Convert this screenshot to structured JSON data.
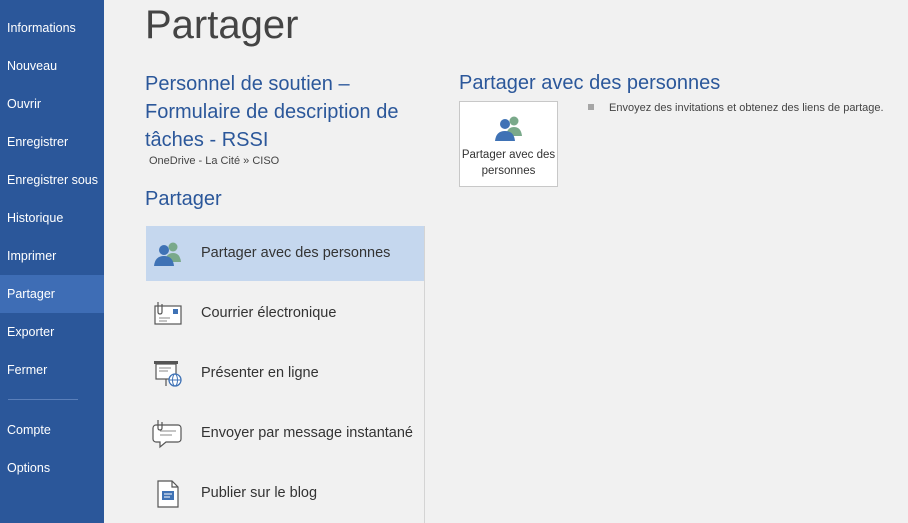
{
  "sidebar": {
    "items": [
      {
        "label": "Informations"
      },
      {
        "label": "Nouveau"
      },
      {
        "label": "Ouvrir"
      },
      {
        "label": "Enregistrer"
      },
      {
        "label": "Enregistrer sous"
      },
      {
        "label": "Historique"
      },
      {
        "label": "Imprimer"
      },
      {
        "label": "Partager",
        "active": true
      },
      {
        "label": "Exporter"
      },
      {
        "label": "Fermer"
      },
      {
        "label": "Compte"
      },
      {
        "label": "Options"
      }
    ]
  },
  "page": {
    "title": "Partager"
  },
  "document": {
    "title": "Personnel de soutien – Formulaire de description de tâches - RSSI",
    "path": "OneDrive - La Cité » CISO"
  },
  "share": {
    "section_title": "Partager",
    "options": [
      {
        "label": "Partager avec des personnes",
        "icon": "people-icon",
        "selected": true
      },
      {
        "label": "Courrier électronique",
        "icon": "email-icon"
      },
      {
        "label": "Présenter en ligne",
        "icon": "present-online-icon"
      },
      {
        "label": "Envoyer par message instantané",
        "icon": "instant-message-icon"
      },
      {
        "label": "Publier sur le blog",
        "icon": "blog-icon"
      }
    ]
  },
  "detail": {
    "title": "Partager avec des personnes",
    "button_label": "Partager avec des personnes",
    "bullet": "Envoyez des invitations et obtenez des liens de partage."
  },
  "colors": {
    "accent": "#2b579a",
    "sidebar_active": "#3e6db5",
    "selected": "#c5d7ee"
  }
}
